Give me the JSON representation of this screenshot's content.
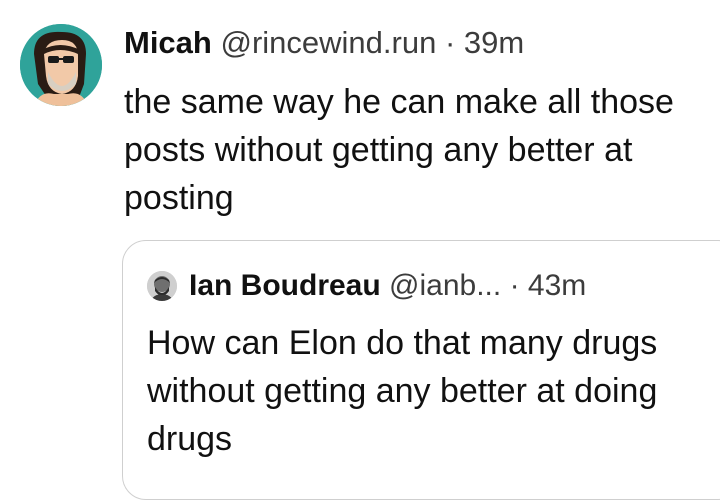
{
  "post": {
    "author_name": "Micah",
    "handle": "@rincewind.run",
    "separator": "·",
    "time": "39m",
    "text": "the same way he can make all those posts without getting any better at posting",
    "avatar_icon": "cartoon-man-avatar-icon",
    "avatar_bg": "#2fa39a"
  },
  "quoted_post": {
    "author_name": "Ian Boudreau",
    "handle": "@ianb...",
    "separator": "·",
    "time": "43m",
    "text": "How can Elon do that many drugs without getting any better at doing drugs",
    "avatar_icon": "bearded-man-avatar-icon"
  }
}
